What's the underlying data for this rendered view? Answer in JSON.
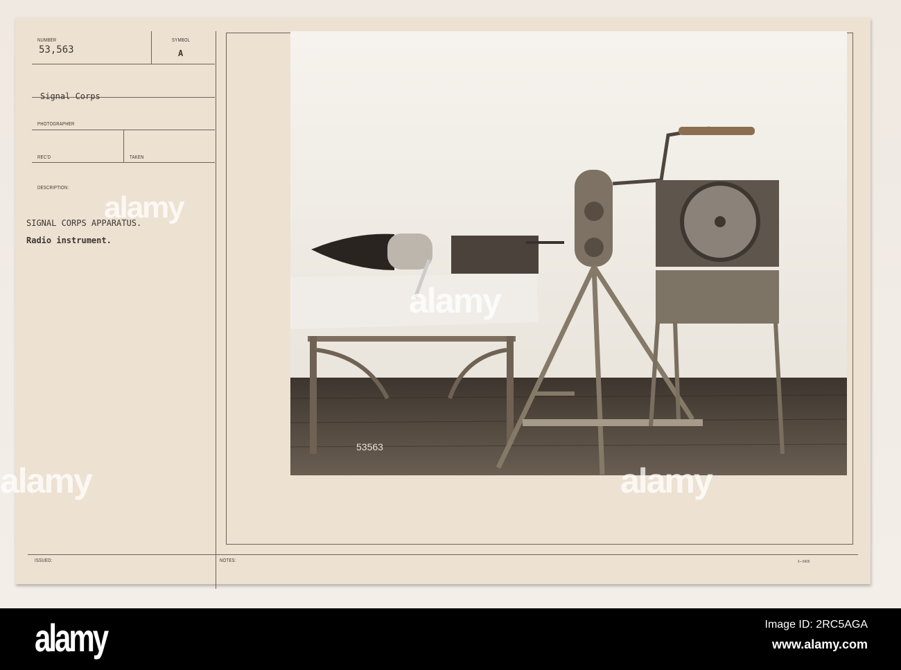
{
  "card": {
    "number_label": "NUMBER",
    "number_value": "53,563",
    "symbol_label": "SYMBOL",
    "symbol_value": "A",
    "source": "Signal Corps",
    "photographer_label": "PHOTOGRAPHER",
    "recd_label": "REC'D",
    "taken_label": "TAKEN",
    "description_label": "DESCRIPTION:",
    "description_line1": "SIGNAL CORPS APPARATUS.",
    "description_line2": "Radio instrument.",
    "issued_label": "ISSUED:",
    "notes_label": "NOTES:",
    "form_code": "3—5605",
    "photo_number": "53563"
  },
  "watermark": {
    "text": "alamy"
  },
  "footer": {
    "logo": "alamy",
    "image_id": "Image ID: 2RC5AGA",
    "url": "www.alamy.com"
  }
}
